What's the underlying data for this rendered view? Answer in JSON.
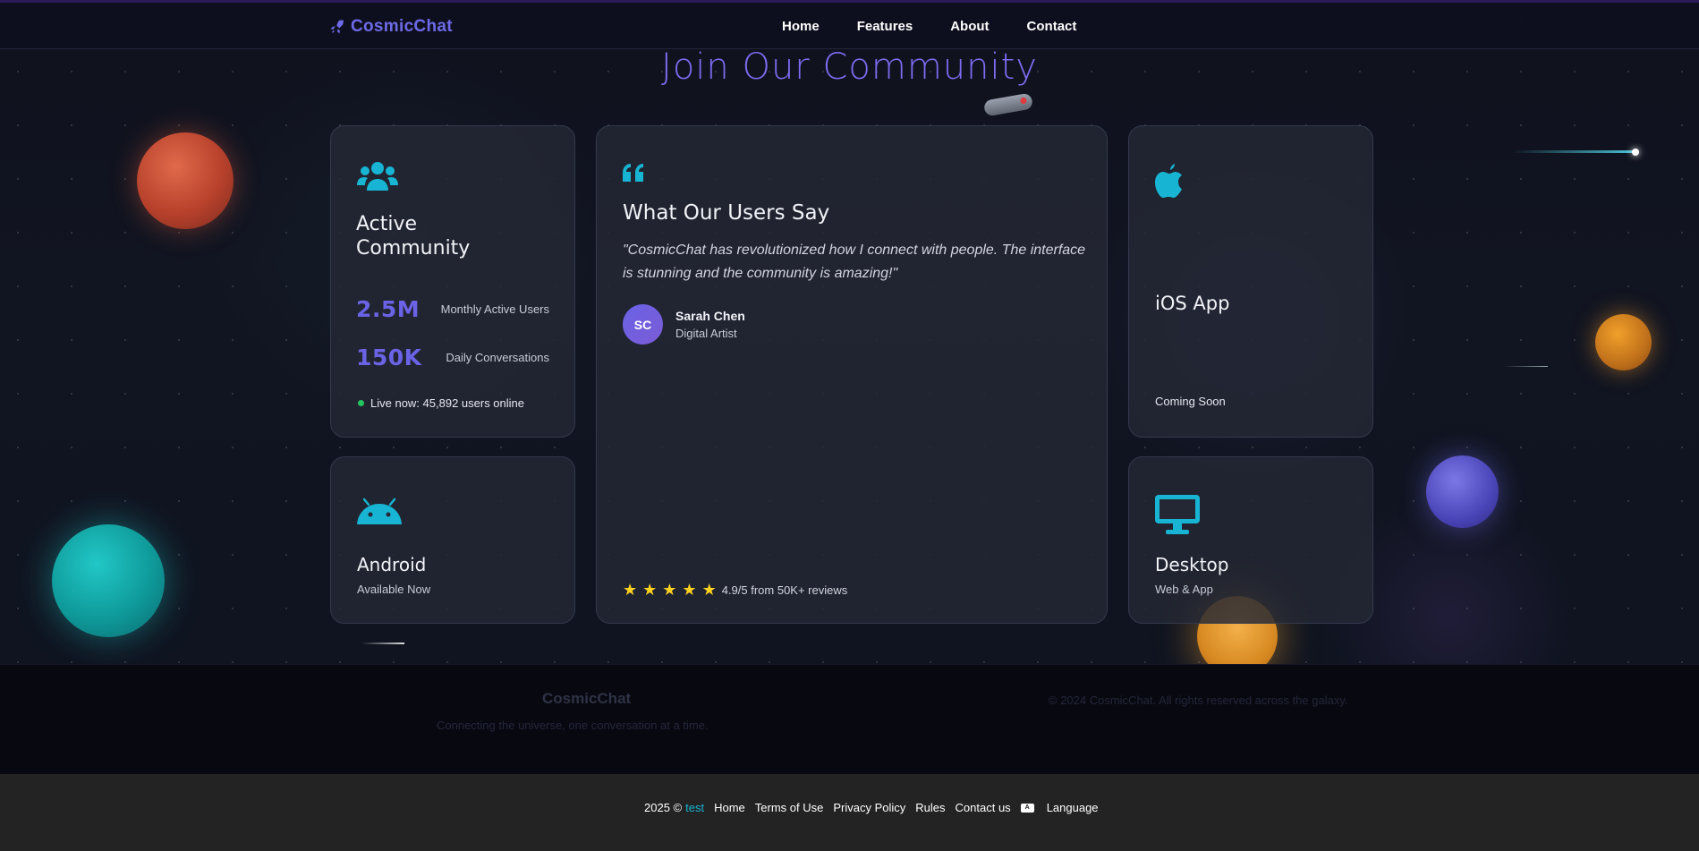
{
  "header": {
    "brand": "CosmicChat",
    "nav": [
      "Home",
      "Features",
      "About",
      "Contact"
    ]
  },
  "page_title": "Join Our Community",
  "community_card": {
    "title_line1": "Active",
    "title_line2": "Community",
    "stats": [
      {
        "value": "2.5M",
        "label": "Monthly Active Users"
      },
      {
        "value": "150K",
        "label": "Daily Conversations"
      }
    ],
    "live": "Live now: 45,892 users online"
  },
  "testimonial": {
    "heading": "What Our Users Say",
    "quote": "\"CosmicChat has revolutionized how I connect with people. The interface is stunning and the community is amazing!\"",
    "avatar_initials": "SC",
    "author": "Sarah Chen",
    "role": "Digital Artist",
    "rating_text": "4.9/5 from 50K+ reviews",
    "star_count": 5
  },
  "ios_card": {
    "title": "iOS App",
    "subtitle": "Coming Soon",
    "icon": "apple-icon"
  },
  "android_card": {
    "title": "Android",
    "subtitle": "Available Now",
    "icon": "android-icon"
  },
  "desktop_card": {
    "title": "Desktop",
    "subtitle": "Web & App",
    "icon": "desktop-icon"
  },
  "site_footer": {
    "brand": "CosmicChat",
    "tagline": "Connecting the universe, one conversation at a time.",
    "copyright": "© 2024 CosmicChat. All rights reserved across the galaxy."
  },
  "bottom_bar": {
    "year": "2025 ©",
    "owner_link": "test",
    "links": [
      "Home",
      "Terms of Use",
      "Privacy Policy",
      "Rules",
      "Contact us"
    ],
    "language": "Language"
  },
  "colors": {
    "accent_purple": "#6b63e6",
    "accent_cyan": "#18b4d3",
    "star_yellow": "#ffd21f",
    "live_green": "#22c55e"
  }
}
